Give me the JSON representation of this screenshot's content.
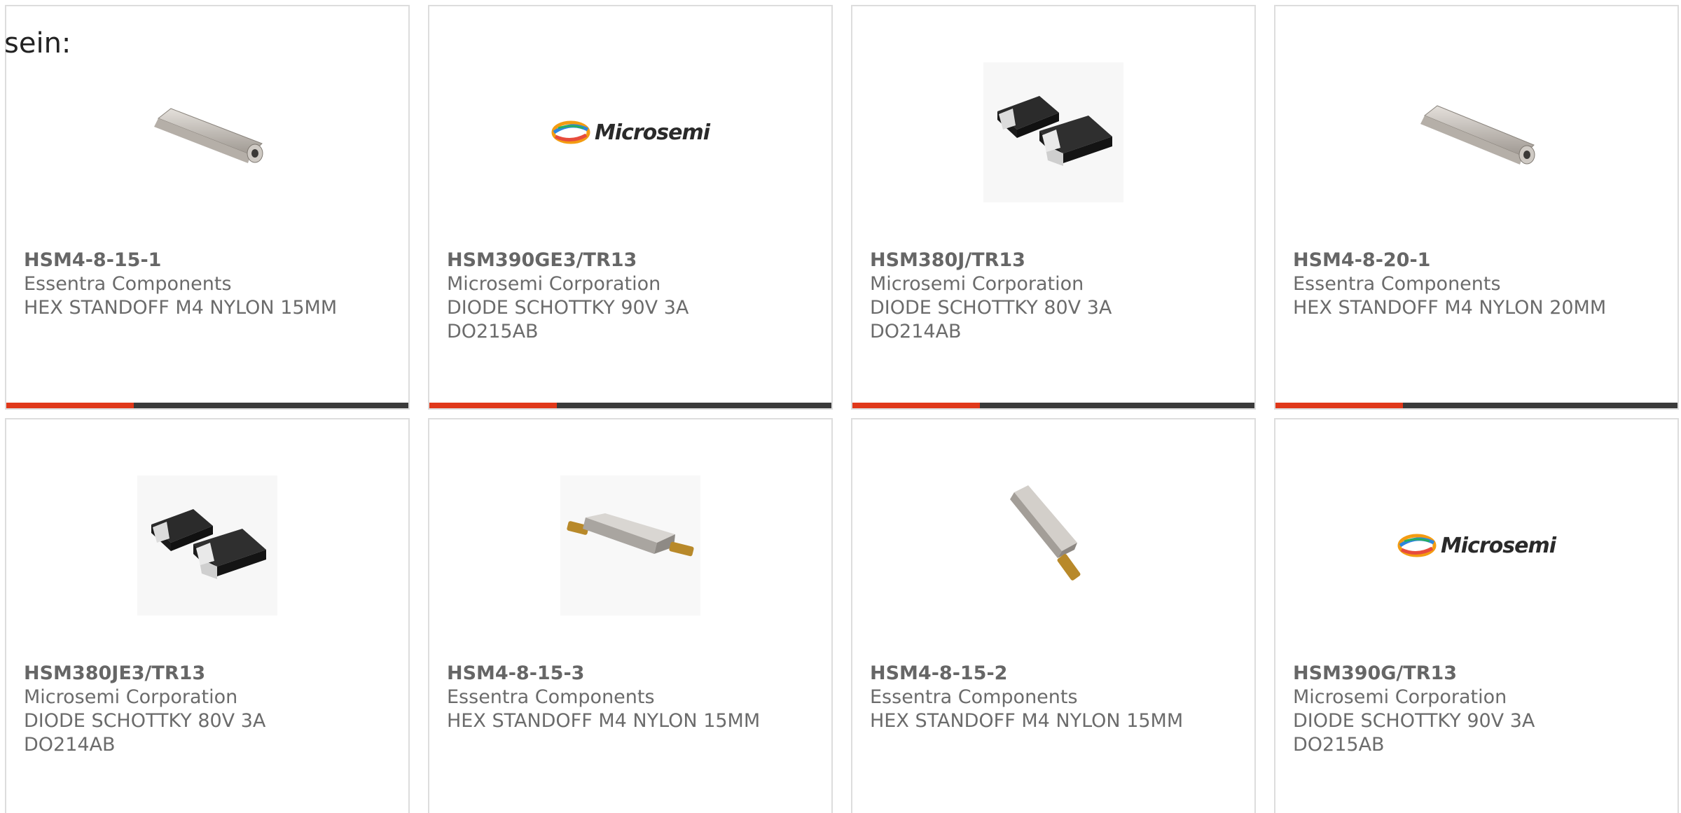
{
  "intro_text": "sein:",
  "colors": {
    "accent_red": "#e0381a",
    "accent_dark": "#3a3a3a",
    "text_gray": "#6b6b6b",
    "card_border": "#dddddd"
  },
  "products": [
    {
      "part": "HSM4-8-15-1",
      "manufacturer": "Essentra Components",
      "desc1": "HEX STANDOFF M4 NYLON 15MM",
      "desc2": "",
      "image": "hex-standoff-icon"
    },
    {
      "part": "HSM390GE3/TR13",
      "manufacturer": "Microsemi Corporation",
      "desc1": "DIODE SCHOTTKY 90V 3A",
      "desc2": "DO215AB",
      "image": "microsemi-logo",
      "logo_text": "Microsemi"
    },
    {
      "part": "HSM380J/TR13",
      "manufacturer": "Microsemi Corporation",
      "desc1": "DIODE SCHOTTKY 80V 3A",
      "desc2": "DO214AB",
      "image": "smd-diode-icon"
    },
    {
      "part": "HSM4-8-20-1",
      "manufacturer": "Essentra Components",
      "desc1": "HEX STANDOFF M4 NYLON 20MM",
      "desc2": "",
      "image": "hex-standoff-icon"
    },
    {
      "part": "HSM380JE3/TR13",
      "manufacturer": "Microsemi Corporation",
      "desc1": "DIODE SCHOTTKY 80V 3A",
      "desc2": "DO214AB",
      "image": "smd-diode-icon"
    },
    {
      "part": "HSM4-8-15-3",
      "manufacturer": "Essentra Components",
      "desc1": "HEX STANDOFF M4 NYLON 15MM",
      "desc2": "",
      "image": "threaded-standoff-icon"
    },
    {
      "part": "HSM4-8-15-2",
      "manufacturer": "Essentra Components",
      "desc1": "HEX STANDOFF M4 NYLON 15MM",
      "desc2": "",
      "image": "male-female-standoff-icon"
    },
    {
      "part": "HSM390G/TR13",
      "manufacturer": "Microsemi Corporation",
      "desc1": "DIODE SCHOTTKY 90V 3A",
      "desc2": "DO215AB",
      "image": "microsemi-logo",
      "logo_text": "Microsemi"
    }
  ]
}
